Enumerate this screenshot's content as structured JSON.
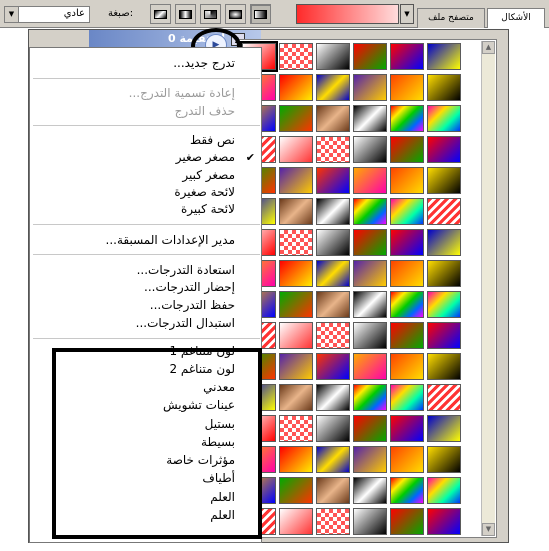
{
  "toolbar": {
    "mode_value": "عادي",
    "mode_label": "صبغة:",
    "tabs": [
      "الأشكال",
      "متصفح ملف"
    ]
  },
  "panel": {
    "header_title": "أستقيمة 0"
  },
  "menu": {
    "new": "تدرج جديد...",
    "rename": "إعادة تسمية التدرج...",
    "delete": "حذف التدرج",
    "text_only": "نص فقط",
    "small_thumb": "مصغر صغير",
    "large_thumb": "مصغر كبير",
    "small_list": "لائحة صغيرة",
    "large_list": "لائحة كبيرة",
    "preset_manager": "مدير الإعدادات المسبقة...",
    "reset": "استعادة التدرجات...",
    "load": "إحضار التدرجات...",
    "save": "حفظ التدرجات...",
    "replace": "استبدال التدرجات...",
    "sets": [
      "لون متناغم 1",
      "لون متناغم 2",
      "معدني",
      "عينات تشويش",
      "بستيل",
      "بسيطة",
      "مؤثرات خاصة",
      "أطياف",
      "العلم",
      "العلم"
    ]
  },
  "gradients": {
    "swatches": [
      "linear-gradient(135deg,#ffffff,#ff0000)",
      "repeating-conic-gradient(#ff5555 0 25%,#ffffff 0 50%) 0 0/8px 8px",
      "linear-gradient(135deg,#ffffff,#000000)",
      "linear-gradient(135deg,#ff0000,#00aa00)",
      "linear-gradient(135deg,#ff0000,#0000ff)",
      "linear-gradient(135deg,#0000cc,#ffff00)",
      "linear-gradient(135deg,#ffaa00,#ff00aa)",
      "linear-gradient(135deg,#ff0000,#ffee00)",
      "linear-gradient(135deg,#0000cc,#ffdd00,#0000cc)",
      "linear-gradient(135deg,#5522aa,#ffcc00)",
      "linear-gradient(135deg,#ff4400,#ffdd00)",
      "linear-gradient(135deg,#ffdd00,#000000)",
      "linear-gradient(135deg,#ffaa00,#0000ff)",
      "linear-gradient(135deg,#00aa00,#ff3300)",
      "linear-gradient(135deg,#6b3a1a,#e8b48a,#6b3a1a)",
      "linear-gradient(135deg,#000000,#ffffff,#000000)",
      "linear-gradient(135deg,#ff0000,#ffee00,#00cc00,#0066ff,#ff00ff)",
      "linear-gradient(135deg,#ff00aa,#ffdd00,#00ffaa,#0033ff)",
      "repeating-linear-gradient(135deg,#ff3333 0 3px,#ffffff 3px 6px)",
      "linear-gradient(135deg,#ffffff,#ff3333)",
      "repeating-conic-gradient(#ff5555 0 25%,#ffffff 0 50%) 0 0/8px 8px",
      "linear-gradient(135deg,#ffffff,#000000)",
      "linear-gradient(135deg,#ff0000,#00aa00)",
      "linear-gradient(135deg,#ff0000,#0000ff)",
      "linear-gradient(135deg,#00aa00,#ff3300)",
      "linear-gradient(135deg,#5522aa,#ffcc00)",
      "linear-gradient(135deg,#ff3300,#0000ff)",
      "linear-gradient(135deg,#ffaa00,#ff00aa)",
      "linear-gradient(135deg,#ff4400,#ffdd00)",
      "linear-gradient(135deg,#ffdd00,#000000)",
      "linear-gradient(135deg,#0000cc,#ffff00)",
      "linear-gradient(135deg,#6b3a1a,#e8b48a,#6b3a1a)",
      "linear-gradient(135deg,#000000,#ffffff,#000000)",
      "linear-gradient(135deg,#ff0000,#ffee00,#00cc00,#0066ff,#ff00ff)",
      "linear-gradient(135deg,#ff00aa,#ffdd00,#00ffaa,#0033ff)",
      "repeating-linear-gradient(135deg,#ff3333 0 3px,#ffffff 3px 6px)"
    ],
    "selected_index": 0
  }
}
